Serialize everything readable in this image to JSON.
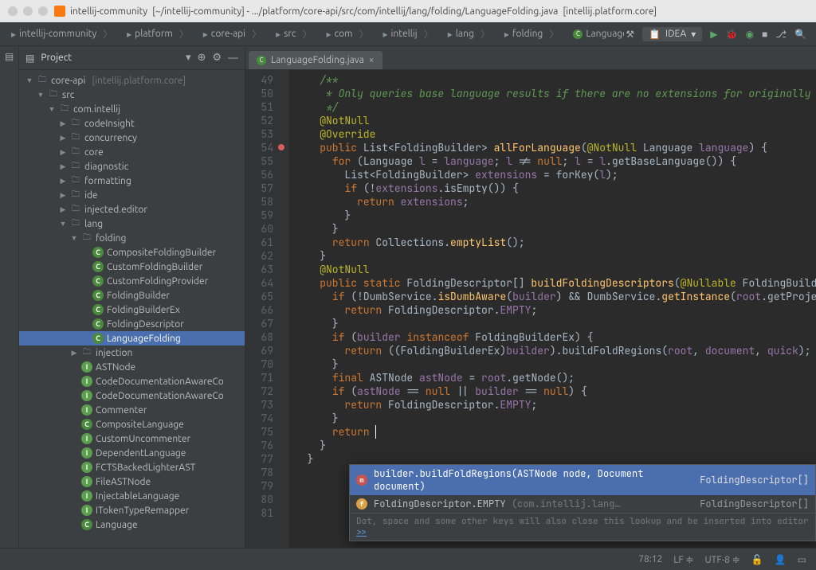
{
  "title": {
    "project": "intellij-community",
    "path": "[~/intellij-community] - .../platform/core-api/src/com/intellij/lang/folding/LanguageFolding.java",
    "module": "[intellij.platform.core]"
  },
  "breadcrumbs": [
    {
      "label": "intellij-community",
      "kind": "folder"
    },
    {
      "label": "platform",
      "kind": "folder"
    },
    {
      "label": "core-api",
      "kind": "folder"
    },
    {
      "label": "src",
      "kind": "folder"
    },
    {
      "label": "com",
      "kind": "folder"
    },
    {
      "label": "intellij",
      "kind": "folder"
    },
    {
      "label": "lang",
      "kind": "folder"
    },
    {
      "label": "folding",
      "kind": "folder"
    },
    {
      "label": "LanguageFolding",
      "kind": "class"
    }
  ],
  "run_config": "IDEA",
  "project_panel": {
    "title": "Project"
  },
  "tree": [
    {
      "d": 0,
      "a": "down",
      "ic": "folder",
      "label": "core-api",
      "sub": "[intellij.platform.core]"
    },
    {
      "d": 1,
      "a": "down",
      "ic": "folder",
      "label": "src"
    },
    {
      "d": 2,
      "a": "down",
      "ic": "pkg",
      "label": "com.intellij"
    },
    {
      "d": 3,
      "a": "right",
      "ic": "pkg",
      "label": "codeInsight"
    },
    {
      "d": 3,
      "a": "right",
      "ic": "pkg",
      "label": "concurrency"
    },
    {
      "d": 3,
      "a": "right",
      "ic": "pkg",
      "label": "core"
    },
    {
      "d": 3,
      "a": "right",
      "ic": "pkg",
      "label": "diagnostic"
    },
    {
      "d": 3,
      "a": "right",
      "ic": "pkg",
      "label": "formatting"
    },
    {
      "d": 3,
      "a": "right",
      "ic": "pkg",
      "label": "ide"
    },
    {
      "d": 3,
      "a": "right",
      "ic": "pkg",
      "label": "injected.editor"
    },
    {
      "d": 3,
      "a": "down",
      "ic": "pkg",
      "label": "lang"
    },
    {
      "d": 4,
      "a": "down",
      "ic": "pkg",
      "label": "folding"
    },
    {
      "d": 5,
      "a": "none",
      "ic": "cls",
      "label": "CompositeFoldingBuilder"
    },
    {
      "d": 5,
      "a": "none",
      "ic": "cls",
      "label": "CustomFoldingBuilder"
    },
    {
      "d": 5,
      "a": "none",
      "ic": "cls",
      "label": "CustomFoldingProvider"
    },
    {
      "d": 5,
      "a": "none",
      "ic": "cls",
      "label": "FoldingBuilder"
    },
    {
      "d": 5,
      "a": "none",
      "ic": "cls",
      "label": "FoldingBuilderEx"
    },
    {
      "d": 5,
      "a": "none",
      "ic": "cls",
      "label": "FoldingDescriptor"
    },
    {
      "d": 5,
      "a": "none",
      "ic": "cls",
      "label": "LanguageFolding",
      "selected": true
    },
    {
      "d": 4,
      "a": "right",
      "ic": "pkg",
      "label": "injection"
    },
    {
      "d": 4,
      "a": "none",
      "ic": "iface",
      "label": "ASTNode"
    },
    {
      "d": 4,
      "a": "none",
      "ic": "iface",
      "label": "CodeDocumentationAwareCo"
    },
    {
      "d": 4,
      "a": "none",
      "ic": "iface",
      "label": "CodeDocumentationAwareCo"
    },
    {
      "d": 4,
      "a": "none",
      "ic": "iface",
      "label": "Commenter"
    },
    {
      "d": 4,
      "a": "none",
      "ic": "cls",
      "label": "CompositeLanguage"
    },
    {
      "d": 4,
      "a": "none",
      "ic": "iface",
      "label": "CustomUncommenter"
    },
    {
      "d": 4,
      "a": "none",
      "ic": "iface",
      "label": "DependentLanguage"
    },
    {
      "d": 4,
      "a": "none",
      "ic": "iface",
      "label": "FCTSBackedLighterAST"
    },
    {
      "d": 4,
      "a": "none",
      "ic": "iface",
      "label": "FileASTNode"
    },
    {
      "d": 4,
      "a": "none",
      "ic": "iface",
      "label": "InjectableLanguage"
    },
    {
      "d": 4,
      "a": "none",
      "ic": "iface",
      "label": "ITokenTypeRemapper"
    },
    {
      "d": 4,
      "a": "none",
      "ic": "cls",
      "label": "Language"
    }
  ],
  "tab": {
    "label": "LanguageFolding.java"
  },
  "gutter": {
    "start": 49,
    "end": 81,
    "breakpoint_line": 54
  },
  "code": [
    {
      "n": 49,
      "i": 2,
      "html": "<span class='doc'>/**</span>"
    },
    {
      "n": 50,
      "i": 2,
      "html": "<span class='doc'> * Only queries base language results if there are no extensions for originally requested </span>"
    },
    {
      "n": 51,
      "i": 2,
      "html": "<span class='doc'> */</span>"
    },
    {
      "n": 52,
      "i": 2,
      "html": "<span class='ann'>@NotNull</span>"
    },
    {
      "n": 53,
      "i": 2,
      "html": "<span class='ann'>@Override</span>"
    },
    {
      "n": 54,
      "i": 2,
      "html": "<span class='kw'>public</span> List&lt;FoldingBuilder&gt; <span class='fn'>allForLanguage</span>(<span class='ann'>@NotNull</span> Language <span class='param'>language</span>) {"
    },
    {
      "n": 55,
      "i": 3,
      "html": "<span class='kw'>for</span> (Language <span class='param'>l</span> = <span class='param'>language</span>; <span class='param'>l</span> != <span class='kw'>null</span>; <span class='param'>l</span> = <span class='param'>l</span>.getBaseLanguage()) {"
    },
    {
      "n": 56,
      "i": 4,
      "html": "List&lt;FoldingBuilder&gt; <span class='param'>extensions</span> = forKey(<span class='param'>l</span>);"
    },
    {
      "n": 57,
      "i": 4,
      "html": "<span class='kw'>if</span> (!<span class='param'>extensions</span>.isEmpty()) {"
    },
    {
      "n": 58,
      "i": 5,
      "html": "<span class='kw'>return</span> <span class='param'>extensions</span>;"
    },
    {
      "n": 59,
      "i": 4,
      "html": "}"
    },
    {
      "n": 60,
      "i": 3,
      "html": "}"
    },
    {
      "n": 61,
      "i": 3,
      "html": "<span class='kw'>return</span> Collections.<span class='fn'>emptyList</span>();"
    },
    {
      "n": 62,
      "i": 2,
      "html": "}"
    },
    {
      "n": 63,
      "i": 0,
      "html": ""
    },
    {
      "n": 64,
      "i": 2,
      "html": "<span class='ann'>@NotNull</span>"
    },
    {
      "n": 65,
      "i": 2,
      "html": "<span class='kw'>public static</span> FoldingDescriptor[] <span class='fn'>buildFoldingDescriptors</span>(<span class='ann'>@Nullable</span> FoldingBuilder <span class='param'>builder</span>"
    },
    {
      "n": 66,
      "i": 3,
      "html": "<span class='kw'>if</span> (!DumbService.<span class='fn'>isDumbAware</span>(<span class='param'>builder</span>) && DumbService.<span class='fn'>getInstance</span>(<span class='param'>root</span>.getProject()).isDum"
    },
    {
      "n": 67,
      "i": 4,
      "html": "<span class='kw'>return</span> FoldingDescriptor.<span class='param'>EMPTY</span>;"
    },
    {
      "n": 68,
      "i": 3,
      "html": "}"
    },
    {
      "n": 69,
      "i": 0,
      "html": ""
    },
    {
      "n": 70,
      "i": 3,
      "html": "<span class='kw'>if</span> (<span class='param'>builder</span> <span class='kw'>instanceof</span> FoldingBuilderEx) {"
    },
    {
      "n": 71,
      "i": 4,
      "html": "<span class='kw'>return</span> ((FoldingBuilderEx)<span class='param'>builder</span>).buildFoldRegions(<span class='param'>root</span>, <span class='param'>document</span>, <span class='param'>quick</span>);"
    },
    {
      "n": 72,
      "i": 3,
      "html": "}"
    },
    {
      "n": 73,
      "i": 3,
      "html": "<span class='kw'>final</span> ASTNode <span class='param'>astNode</span> = <span class='param'>root</span>.getNode();"
    },
    {
      "n": 74,
      "i": 3,
      "html": "<span class='kw'>if</span> (<span class='param'>astNode</span> == <span class='kw'>null</span> || <span class='param'>builder</span> == <span class='kw'>null</span>) {"
    },
    {
      "n": 75,
      "i": 4,
      "html": "<span class='kw'>return</span> FoldingDescriptor.<span class='param'>EMPTY</span>;"
    },
    {
      "n": 76,
      "i": 3,
      "html": "}"
    },
    {
      "n": 77,
      "i": 0,
      "html": ""
    },
    {
      "n": 78,
      "i": 3,
      "html": "<span class='kw'>return</span> <span class='caret'></span>"
    },
    {
      "n": 79,
      "i": 2,
      "html": "}"
    },
    {
      "n": 80,
      "i": 1,
      "html": "}"
    },
    {
      "n": 81,
      "i": 0,
      "html": ""
    }
  ],
  "completion": {
    "items": [
      {
        "icon": "m",
        "color": "red",
        "sig": "builder.buildFoldRegions(ASTNode node, Document document)",
        "ret": "FoldingDescriptor[]",
        "sel": true
      },
      {
        "icon": "f",
        "color": "orange",
        "sig": "FoldingDescriptor.EMPTY",
        "dim": "(com.intellij.lang…",
        "ret": "FoldingDescriptor[]"
      }
    ],
    "hint": "Dot, space and some other keys will also close this lookup and be inserted into editor",
    "hint_link": ">>"
  },
  "status": {
    "pos": "78:12",
    "line_sep": "LF",
    "enc": "UTF-8"
  }
}
